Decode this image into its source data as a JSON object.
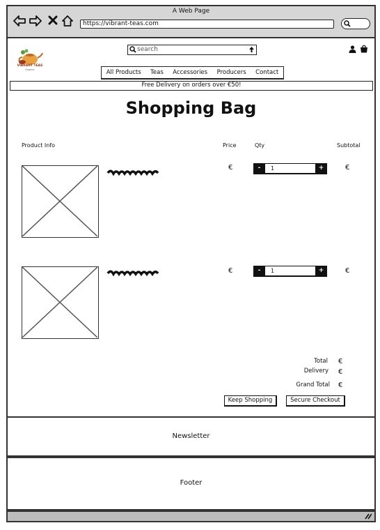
{
  "browser": {
    "window_title": "A Web Page",
    "url": "https://vibrant-teas.com",
    "icons": [
      "back-arrow-icon",
      "forward-arrow-icon",
      "close-x-icon",
      "home-icon",
      "search-icon"
    ]
  },
  "header": {
    "logo_name": "VIBRANT TEAS",
    "logo_sub": "Organic",
    "search_placeholder": "search",
    "nav": [
      "All Products",
      "Teas",
      "Accessories",
      "Producers",
      "Contact"
    ]
  },
  "promo": "Free Delivery on orders over €50!",
  "page_title": "Shopping Bag",
  "columns": {
    "product": "Product Info",
    "price": "Price",
    "qty": "Qty",
    "subtotal": "Subtotal"
  },
  "items": [
    {
      "price": "€",
      "qty_minus": "-",
      "qty": "1",
      "qty_plus": "+",
      "subtotal": "€"
    },
    {
      "price": "€",
      "qty_minus": "-",
      "qty": "1",
      "qty_plus": "+",
      "subtotal": "€"
    }
  ],
  "totals": {
    "total_label": "Total",
    "total_value": "€",
    "delivery_label": "Delivery",
    "delivery_value": "€",
    "grand_total_label": "Grand Total",
    "grand_total_value": "€"
  },
  "actions": {
    "keep_shopping": "Keep Shopping",
    "secure_checkout": "Secure Checkout"
  },
  "newsletter": "Newsletter",
  "footer": "Footer"
}
